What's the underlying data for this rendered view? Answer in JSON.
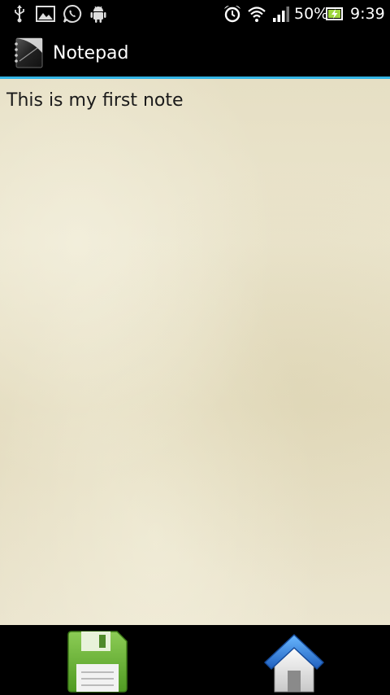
{
  "status_bar": {
    "battery_percent": "50%",
    "time": "9:39",
    "icons": [
      "usb-icon",
      "gallery-icon",
      "whatsapp-icon",
      "android-icon",
      "alarm-icon",
      "wifi-icon",
      "signal-icon",
      "battery-icon"
    ]
  },
  "action_bar": {
    "app_icon": "notepad-icon",
    "title": "Notepad",
    "accent_color": "#33b5e5"
  },
  "note": {
    "text": "This is my first note",
    "background_color": "#e8e1c7"
  },
  "bottom_bar": {
    "buttons": [
      {
        "name": "save-button",
        "icon": "floppy-disk-icon",
        "color": "#6db33f"
      },
      {
        "name": "home-button",
        "icon": "house-icon",
        "color": "#2a7fd4"
      }
    ]
  }
}
